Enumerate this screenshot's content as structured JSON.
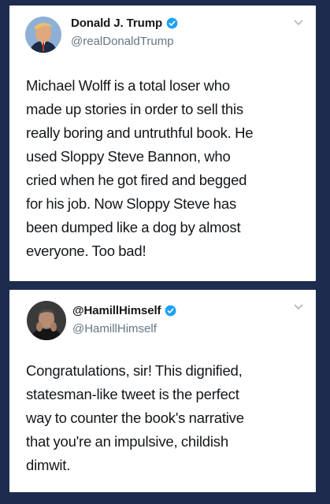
{
  "tweets": [
    {
      "author": {
        "display_name": "Donald J. Trump",
        "handle": "@realDonaldTrump",
        "verified": true
      },
      "text_lines": [
        "Michael Wolff is a total loser who",
        "made up stories in order to sell this",
        "really boring and untruthful book. He",
        "used Sloppy Steve Bannon, who",
        "cried when he got fired and begged",
        "for his job. Now Sloppy Steve has",
        "been dumped like a dog by almost",
        "everyone. Too bad!"
      ]
    },
    {
      "author": {
        "display_name": "@HamillHimself",
        "handle": "@HamillHimself",
        "verified": true
      },
      "text_lines": [
        "Congratulations, sir! This dignified,",
        "statesman-like tweet is the perfect",
        "way to counter the book's narrative",
        "that you're an impulsive, childish",
        "dimwit."
      ]
    }
  ],
  "icons": {
    "verified": "verified-badge-icon",
    "caret": "chevron-down-icon"
  },
  "colors": {
    "background": "#1d2b4f",
    "card": "#ffffff",
    "verified": "#1da1f2",
    "handle": "#657786",
    "text": "#14171a"
  }
}
